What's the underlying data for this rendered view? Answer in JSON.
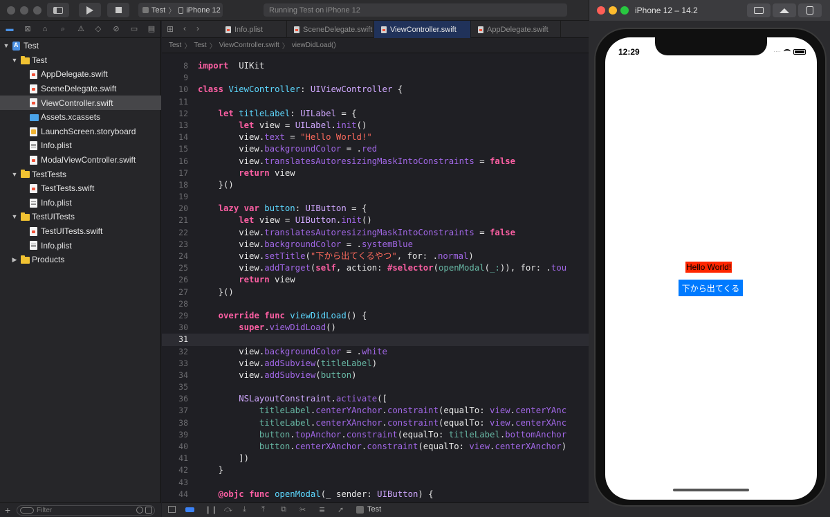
{
  "toolbar": {
    "scheme_project": "Test",
    "scheme_device": "iPhone 12",
    "activity": "Running Test on iPhone 12"
  },
  "simulator": {
    "title": "iPhone 12 – 14.2",
    "status_time": "12:29",
    "label_text": "Hello World!",
    "button_text": "下から出てくる"
  },
  "navigator": {
    "filter_placeholder": "Filter",
    "tree": [
      {
        "label": "Test",
        "depth": 0,
        "kind": "project",
        "disclosure": "open"
      },
      {
        "label": "Test",
        "depth": 1,
        "kind": "folder",
        "disclosure": "open"
      },
      {
        "label": "AppDelegate.swift",
        "depth": 2,
        "kind": "swift"
      },
      {
        "label": "SceneDelegate.swift",
        "depth": 2,
        "kind": "swift"
      },
      {
        "label": "ViewController.swift",
        "depth": 2,
        "kind": "swift",
        "selected": true
      },
      {
        "label": "Assets.xcassets",
        "depth": 2,
        "kind": "assets"
      },
      {
        "label": "LaunchScreen.storyboard",
        "depth": 2,
        "kind": "storyboard"
      },
      {
        "label": "Info.plist",
        "depth": 2,
        "kind": "plist"
      },
      {
        "label": "ModalViewController.swift",
        "depth": 2,
        "kind": "swift"
      },
      {
        "label": "TestTests",
        "depth": 1,
        "kind": "folder",
        "disclosure": "open"
      },
      {
        "label": "TestTests.swift",
        "depth": 2,
        "kind": "swift"
      },
      {
        "label": "Info.plist",
        "depth": 2,
        "kind": "plist"
      },
      {
        "label": "TestUITests",
        "depth": 1,
        "kind": "folder",
        "disclosure": "open"
      },
      {
        "label": "TestUITests.swift",
        "depth": 2,
        "kind": "swift"
      },
      {
        "label": "Info.plist",
        "depth": 2,
        "kind": "plist"
      },
      {
        "label": "Products",
        "depth": 1,
        "kind": "folder",
        "disclosure": "closed"
      }
    ]
  },
  "editor": {
    "tabs": [
      {
        "label": "Info.plist",
        "active": false
      },
      {
        "label": "SceneDelegate.swift",
        "active": false
      },
      {
        "label": "ViewController.swift",
        "active": true
      },
      {
        "label": "AppDelegate.swift",
        "active": false
      }
    ],
    "breadcrumb": [
      "Test",
      "Test",
      "ViewController.swift",
      "viewDidLoad()"
    ],
    "bottom_scheme": "Test",
    "current_line": "31",
    "lines": [
      {
        "n": "8",
        "tokens": [
          [
            "kw",
            "import"
          ],
          [
            "",
            "  UIKit"
          ]
        ]
      },
      {
        "n": "9",
        "tokens": []
      },
      {
        "n": "10",
        "tokens": [
          [
            "kw",
            "class"
          ],
          [
            "",
            " "
          ],
          [
            "tl",
            "ViewController"
          ],
          [
            "",
            ": "
          ],
          [
            "ty",
            "UIViewController"
          ],
          [
            "",
            " {"
          ]
        ]
      },
      {
        "n": "11",
        "tokens": []
      },
      {
        "n": "12",
        "tokens": [
          [
            "",
            "    "
          ],
          [
            "kw",
            "let"
          ],
          [
            "",
            " "
          ],
          [
            "tl",
            "titleLabel"
          ],
          [
            "",
            ": "
          ],
          [
            "ty",
            "UILabel"
          ],
          [
            "",
            " = {"
          ]
        ]
      },
      {
        "n": "13",
        "tokens": [
          [
            "",
            "        "
          ],
          [
            "kw",
            "let"
          ],
          [
            "",
            " view = "
          ],
          [
            "ty",
            "UILabel"
          ],
          [
            "",
            "."
          ],
          [
            "pr",
            "init"
          ],
          [
            "",
            "()"
          ]
        ]
      },
      {
        "n": "14",
        "tokens": [
          [
            "",
            "        view."
          ],
          [
            "pr",
            "text"
          ],
          [
            "",
            " = "
          ],
          [
            "st",
            "\"Hello World!\""
          ]
        ]
      },
      {
        "n": "15",
        "tokens": [
          [
            "",
            "        view."
          ],
          [
            "pr",
            "backgroundColor"
          ],
          [
            "",
            " = ."
          ],
          [
            "pr",
            "red"
          ]
        ]
      },
      {
        "n": "16",
        "tokens": [
          [
            "",
            "        view."
          ],
          [
            "pr",
            "translatesAutoresizingMaskIntoConstraints"
          ],
          [
            "",
            " = "
          ],
          [
            "kw",
            "false"
          ]
        ]
      },
      {
        "n": "17",
        "tokens": [
          [
            "",
            "        "
          ],
          [
            "kw",
            "return"
          ],
          [
            "",
            " view"
          ]
        ]
      },
      {
        "n": "18",
        "tokens": [
          [
            "",
            "    }()"
          ]
        ]
      },
      {
        "n": "19",
        "tokens": []
      },
      {
        "n": "20",
        "tokens": [
          [
            "",
            "    "
          ],
          [
            "kw",
            "lazy"
          ],
          [
            "",
            " "
          ],
          [
            "kw",
            "var"
          ],
          [
            "",
            " "
          ],
          [
            "tl",
            "button"
          ],
          [
            "",
            ": "
          ],
          [
            "ty",
            "UIButton"
          ],
          [
            "",
            " = {"
          ]
        ]
      },
      {
        "n": "21",
        "tokens": [
          [
            "",
            "        "
          ],
          [
            "kw",
            "let"
          ],
          [
            "",
            " view = "
          ],
          [
            "ty",
            "UIButton"
          ],
          [
            "",
            "."
          ],
          [
            "pr",
            "init"
          ],
          [
            "",
            "()"
          ]
        ]
      },
      {
        "n": "22",
        "tokens": [
          [
            "",
            "        view."
          ],
          [
            "pr",
            "translatesAutoresizingMaskIntoConstraints"
          ],
          [
            "",
            " = "
          ],
          [
            "kw",
            "false"
          ]
        ]
      },
      {
        "n": "23",
        "tokens": [
          [
            "",
            "        view."
          ],
          [
            "pr",
            "backgroundColor"
          ],
          [
            "",
            " = ."
          ],
          [
            "pr",
            "systemBlue"
          ]
        ]
      },
      {
        "n": "24",
        "tokens": [
          [
            "",
            "        view."
          ],
          [
            "pr",
            "setTitle"
          ],
          [
            "",
            "("
          ],
          [
            "st",
            "\"下から出てくるやつ\""
          ],
          [
            "",
            ", for: ."
          ],
          [
            "pr",
            "normal"
          ],
          [
            "",
            ")"
          ]
        ]
      },
      {
        "n": "25",
        "tokens": [
          [
            "",
            "        view."
          ],
          [
            "pr",
            "addTarget"
          ],
          [
            "",
            "("
          ],
          [
            "kw",
            "self"
          ],
          [
            "",
            ", action: "
          ],
          [
            "kw",
            "#selector"
          ],
          [
            "",
            "("
          ],
          [
            "fn",
            "openModal"
          ],
          [
            "",
            "("
          ],
          [
            "fn",
            "_:"
          ],
          [
            "",
            "))"
          ],
          [
            "",
            ", for: ."
          ],
          [
            "pr",
            "tou"
          ]
        ]
      },
      {
        "n": "26",
        "tokens": [
          [
            "",
            "        "
          ],
          [
            "kw",
            "return"
          ],
          [
            "",
            " view"
          ]
        ]
      },
      {
        "n": "27",
        "tokens": [
          [
            "",
            "    }()"
          ]
        ]
      },
      {
        "n": "28",
        "tokens": []
      },
      {
        "n": "29",
        "tokens": [
          [
            "",
            "    "
          ],
          [
            "kw",
            "override"
          ],
          [
            "",
            " "
          ],
          [
            "kw",
            "func"
          ],
          [
            "",
            " "
          ],
          [
            "tl",
            "viewDidLoad"
          ],
          [
            "",
            "() {"
          ]
        ]
      },
      {
        "n": "30",
        "tokens": [
          [
            "",
            "        "
          ],
          [
            "kw",
            "super"
          ],
          [
            "",
            "."
          ],
          [
            "pr",
            "viewDidLoad"
          ],
          [
            "",
            "()"
          ]
        ]
      },
      {
        "n": "31",
        "tokens": []
      },
      {
        "n": "32",
        "tokens": [
          [
            "",
            "        view."
          ],
          [
            "pr",
            "backgroundColor"
          ],
          [
            "",
            " = ."
          ],
          [
            "pr",
            "white"
          ]
        ]
      },
      {
        "n": "33",
        "tokens": [
          [
            "",
            "        view."
          ],
          [
            "pr",
            "addSubview"
          ],
          [
            "",
            "("
          ],
          [
            "fn",
            "titleLabel"
          ],
          [
            "",
            ")"
          ]
        ]
      },
      {
        "n": "34",
        "tokens": [
          [
            "",
            "        view."
          ],
          [
            "pr",
            "addSubview"
          ],
          [
            "",
            "("
          ],
          [
            "fn",
            "button"
          ],
          [
            "",
            ")"
          ]
        ]
      },
      {
        "n": "35",
        "tokens": []
      },
      {
        "n": "36",
        "tokens": [
          [
            "",
            "        "
          ],
          [
            "ty",
            "NSLayoutConstraint"
          ],
          [
            "",
            "."
          ],
          [
            "pr",
            "activate"
          ],
          [
            "",
            "(["
          ]
        ]
      },
      {
        "n": "37",
        "tokens": [
          [
            "",
            "            "
          ],
          [
            "fn",
            "titleLabel"
          ],
          [
            "",
            "."
          ],
          [
            "pr",
            "centerYAnchor"
          ],
          [
            "",
            "."
          ],
          [
            "pr",
            "constraint"
          ],
          [
            "",
            "(equalTo: "
          ],
          [
            "pr",
            "view"
          ],
          [
            "",
            "."
          ],
          [
            "pr",
            "centerYAnc"
          ]
        ]
      },
      {
        "n": "38",
        "tokens": [
          [
            "",
            "            "
          ],
          [
            "fn",
            "titleLabel"
          ],
          [
            "",
            "."
          ],
          [
            "pr",
            "centerXAnchor"
          ],
          [
            "",
            "."
          ],
          [
            "pr",
            "constraint"
          ],
          [
            "",
            "(equalTo: "
          ],
          [
            "pr",
            "view"
          ],
          [
            "",
            "."
          ],
          [
            "pr",
            "centerXAnc"
          ]
        ]
      },
      {
        "n": "39",
        "tokens": [
          [
            "",
            "            "
          ],
          [
            "fn",
            "button"
          ],
          [
            "",
            "."
          ],
          [
            "pr",
            "topAnchor"
          ],
          [
            "",
            "."
          ],
          [
            "pr",
            "constraint"
          ],
          [
            "",
            "(equalTo: "
          ],
          [
            "fn",
            "titleLabel"
          ],
          [
            "",
            "."
          ],
          [
            "pr",
            "bottomAnchor"
          ]
        ]
      },
      {
        "n": "40",
        "tokens": [
          [
            "",
            "            "
          ],
          [
            "fn",
            "button"
          ],
          [
            "",
            "."
          ],
          [
            "pr",
            "centerXAnchor"
          ],
          [
            "",
            "."
          ],
          [
            "pr",
            "constraint"
          ],
          [
            "",
            "(equalTo: "
          ],
          [
            "pr",
            "view"
          ],
          [
            "",
            "."
          ],
          [
            "pr",
            "centerXAnchor"
          ],
          [
            "",
            ")"
          ]
        ]
      },
      {
        "n": "41",
        "tokens": [
          [
            "",
            "        ])"
          ]
        ]
      },
      {
        "n": "42",
        "tokens": [
          [
            "",
            "    }"
          ]
        ]
      },
      {
        "n": "43",
        "tokens": []
      },
      {
        "n": "44",
        "tokens": [
          [
            "",
            "    "
          ],
          [
            "kw",
            "@objc"
          ],
          [
            "",
            " "
          ],
          [
            "kw",
            "func"
          ],
          [
            "",
            " "
          ],
          [
            "tl",
            "openModal"
          ],
          [
            "",
            "(_ sender: "
          ],
          [
            "ty",
            "UIButton"
          ],
          [
            "",
            ") {"
          ]
        ]
      }
    ]
  }
}
